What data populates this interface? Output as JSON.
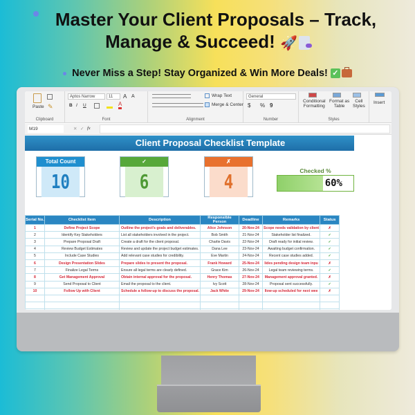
{
  "hero": {
    "title_line1": "Master Your Client Proposals – Track,",
    "title_line2": "Manage & Succeed!",
    "rocket_emoji": "🚀",
    "subtitle": "Never Miss a Step! Stay Organized & Win More Deals!",
    "check_emoji": "✓"
  },
  "ribbon": {
    "clipboard": {
      "paste": "Paste",
      "label": "Clipboard"
    },
    "font": {
      "name": "Aptos Narrow",
      "size": "11",
      "grow": "A",
      "shrink": "A",
      "bold": "B",
      "italic": "I",
      "underline": "U",
      "label": "Font"
    },
    "alignment": {
      "wrap_text": "Wrap Text",
      "merge_center": "Merge & Center",
      "label": "Alignment"
    },
    "number": {
      "format": "General",
      "currency": "$",
      "percent": "%",
      "comma": "9",
      "label": "Number"
    },
    "styles": {
      "conditional_1": "Conditional",
      "conditional_2": "Formatting",
      "format_table_1": "Format as",
      "format_table_2": "Table",
      "cell_styles_1": "Cell",
      "cell_styles_2": "Styles",
      "label": "Styles"
    },
    "cells": {
      "insert": "Insert"
    }
  },
  "formula_bar": {
    "name_box": "M19",
    "fx": "fx",
    "value": ""
  },
  "sheet": {
    "title": "Client Proposal Checklist Template",
    "cards": {
      "total": {
        "label": "Total Count",
        "value": "10",
        "head_color": "#1f8fcf",
        "body_color": "#cfe9f8",
        "value_color": "#1f7fc0"
      },
      "checked": {
        "label": "✓",
        "value": "6",
        "head_color": "#57a83a",
        "body_color": "#d8f0cf",
        "value_color": "#4f9a35"
      },
      "unchecked": {
        "label": "✗",
        "value": "4",
        "head_color": "#e8712e",
        "body_color": "#fbdccb",
        "value_color": "#e0702c"
      }
    },
    "checked_pct": {
      "label": "Checked %",
      "value": 60,
      "text": "60%"
    },
    "columns": [
      "Serial No.",
      "Checklist Item",
      "Description",
      "Responsible Person",
      "Deadline",
      "Remarks",
      "Status"
    ],
    "rows": [
      {
        "no": "1",
        "item": "Define Project Scope",
        "desc": "Outline the project's goals and deliverables.",
        "person": "Alice Johnson",
        "deadline": "20-Nov-24",
        "remarks": "Scope needs validation by client",
        "status": "✗"
      },
      {
        "no": "2",
        "item": "Identify Key Stakeholders",
        "desc": "List all stakeholders involved in the project.",
        "person": "Bob Smith",
        "deadline": "21-Nov-24",
        "remarks": "Stakeholder list finalized.",
        "status": "✓"
      },
      {
        "no": "3",
        "item": "Prepare Proposal Draft",
        "desc": "Create a draft for the client proposal.",
        "person": "Charlie Davis",
        "deadline": "22-Nov-24",
        "remarks": "Draft ready for initial review.",
        "status": "✓"
      },
      {
        "no": "4",
        "item": "Review Budget Estimates",
        "desc": "Review and update the project budget estimates.",
        "person": "Dana Lee",
        "deadline": "23-Nov-24",
        "remarks": "Awaiting budget confirmation.",
        "status": "✓"
      },
      {
        "no": "5",
        "item": "Include Case Studies",
        "desc": "Add relevant case studies for credibility.",
        "person": "Eve Martin",
        "deadline": "24-Nov-24",
        "remarks": "Recent case studies added.",
        "status": "✓"
      },
      {
        "no": "6",
        "item": "Design Presentation Slides",
        "desc": "Prepare slides to present the proposal.",
        "person": "Frank Howard",
        "deadline": "25-Nov-24",
        "remarks": "lides pending design team inpu",
        "status": "✗"
      },
      {
        "no": "7",
        "item": "Finalize Legal Terms",
        "desc": "Ensure all legal terms are clearly defined.",
        "person": "Grace Kim",
        "deadline": "26-Nov-24",
        "remarks": "Legal team reviewing terms.",
        "status": "✓"
      },
      {
        "no": "8",
        "item": "Get Management Approval",
        "desc": "Obtain internal approval for the proposal.",
        "person": "Henry Thomas",
        "deadline": "27-Nov-24",
        "remarks": "Management approval granted.",
        "status": "✗"
      },
      {
        "no": "9",
        "item": "Send Proposal to Client",
        "desc": "Email the proposal to the client.",
        "person": "Ivy Scott",
        "deadline": "28-Nov-24",
        "remarks": "Proposal sent successfully.",
        "status": "✓"
      },
      {
        "no": "10",
        "item": "Follow Up with Client",
        "desc": "Schedule a follow-up to discuss the proposal.",
        "person": "Jack White",
        "deadline": "29-Nov-24",
        "remarks": "llow-up scheduled for next wee",
        "status": "✗"
      }
    ]
  }
}
